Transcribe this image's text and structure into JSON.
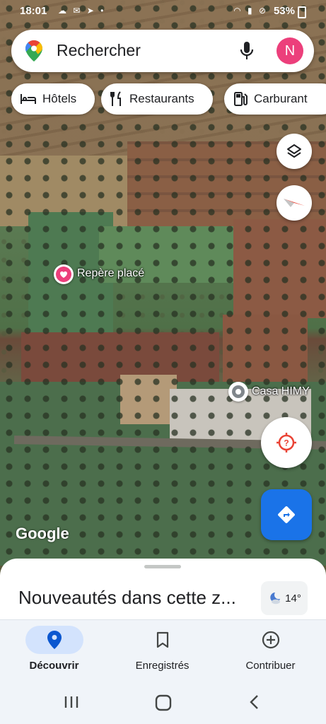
{
  "status_bar": {
    "time": "18:01",
    "notification_icons": "☁ ✉ ➤ •",
    "system_icons": "◠ ▮ ⊘",
    "battery": "53%"
  },
  "search": {
    "placeholder": "Rechercher",
    "avatar_letter": "N"
  },
  "chips": [
    {
      "label": "Hôtels",
      "icon": "bed-icon"
    },
    {
      "label": "Restaurants",
      "icon": "fork-knife-icon"
    },
    {
      "label": "Carburant",
      "icon": "fuel-pump-icon"
    }
  ],
  "map": {
    "markers": [
      {
        "label": "Repère placé",
        "icon": "heart-icon"
      },
      {
        "label": "Casa HIMY",
        "icon": "place-icon"
      }
    ],
    "watermark": "Google"
  },
  "sheet": {
    "title": "Nouveautés dans cette z...",
    "weather_temp": "14°"
  },
  "bottom_nav": [
    {
      "label": "Découvrir",
      "icon": "explore-pin-icon",
      "active": true
    },
    {
      "label": "Enregistrés",
      "icon": "bookmark-icon",
      "active": false
    },
    {
      "label": "Contribuer",
      "icon": "add-circle-icon",
      "active": false
    }
  ],
  "colors": {
    "accent": "#1a73e8",
    "avatar": "#ec3f7b",
    "locate": "#ea4335"
  }
}
